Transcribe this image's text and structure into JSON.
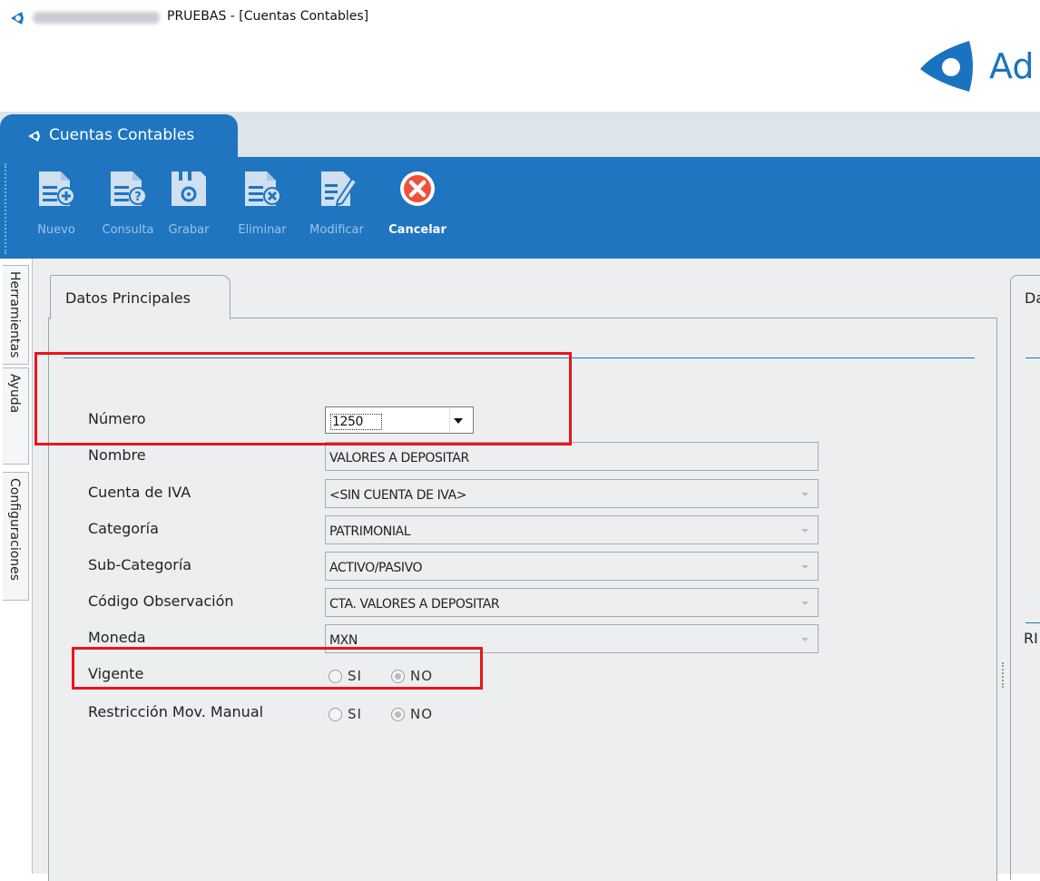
{
  "window": {
    "title": "PRUEBAS - [Cuentas Contables]",
    "brand_text": "Ad"
  },
  "module_tab": {
    "label": "Cuentas Contables"
  },
  "toolbar": {
    "buttons": [
      {
        "label": "Nuevo",
        "icon": "doc-add-icon"
      },
      {
        "label": "Consulta",
        "icon": "doc-question-icon"
      },
      {
        "label": "Grabar",
        "icon": "save-disk-icon"
      },
      {
        "label": "Eliminar",
        "icon": "doc-delete-icon"
      },
      {
        "label": "Modificar",
        "icon": "doc-edit-icon"
      },
      {
        "label": "Cancelar",
        "icon": "cancel-icon"
      }
    ]
  },
  "side_tabs": [
    "Herramientas",
    "Ayuda",
    "Configuraciones"
  ],
  "panel": {
    "tab_label": "Datos Principales",
    "right_tab_label": "Da",
    "right_sub_label": "RI"
  },
  "form": {
    "numero": {
      "label": "Número",
      "value": "1250"
    },
    "nombre": {
      "label": "Nombre",
      "value": "VALORES A DEPOSITAR"
    },
    "cuenta_iva": {
      "label": "Cuenta de IVA",
      "value": "<SIN CUENTA DE IVA>"
    },
    "categoria": {
      "label": "Categoría",
      "value": "PATRIMONIAL"
    },
    "sub_categoria": {
      "label": "Sub-Categoría",
      "value": "ACTIVO/PASIVO"
    },
    "codigo_observacion": {
      "label": "Código Observación",
      "value": "CTA. VALORES A DEPOSITAR"
    },
    "moneda": {
      "label": "Moneda",
      "value": "MXN"
    },
    "vigente": {
      "label": "Vigente",
      "option_si": "SI",
      "option_no": "NO",
      "selected": "NO"
    },
    "restriccion": {
      "label": "Restricción Mov. Manual",
      "option_si": "SI",
      "option_no": "NO",
      "selected": "NO"
    }
  },
  "colors": {
    "accent": "#1f75c0",
    "annotation": "#e8151b",
    "panel_bg": "#eceef0"
  }
}
